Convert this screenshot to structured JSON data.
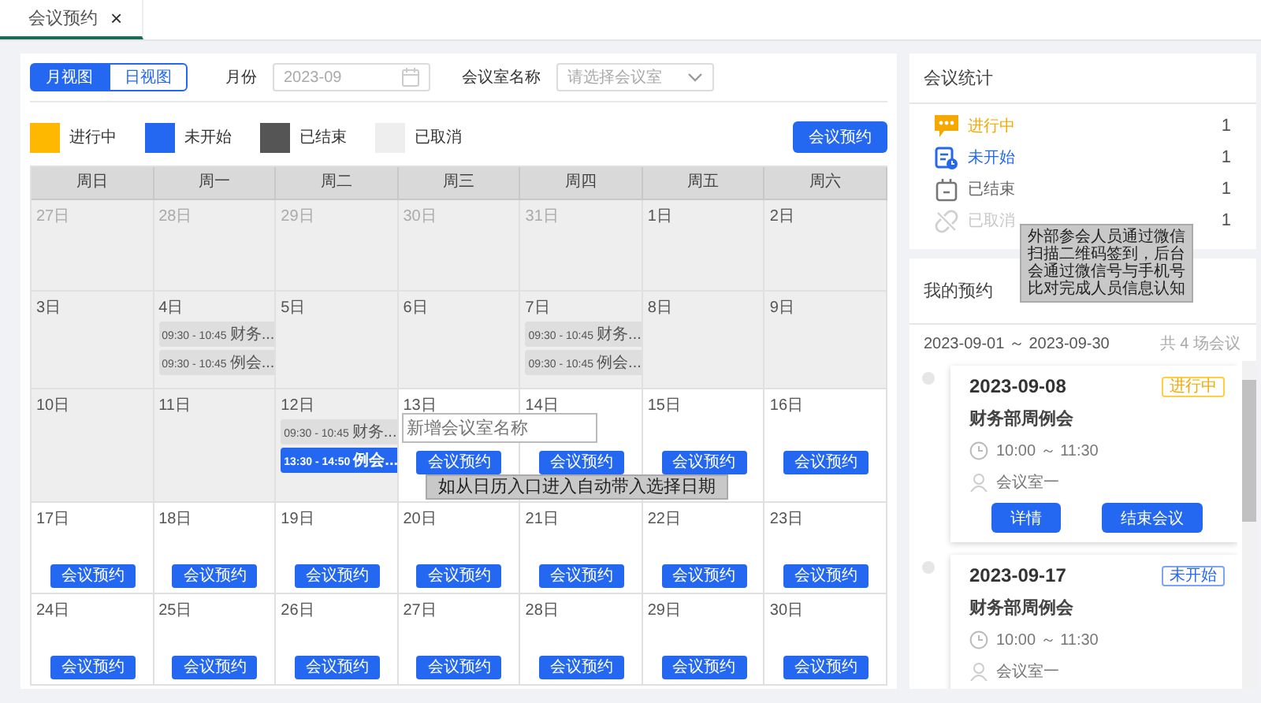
{
  "tabs": [
    {
      "label": "会议预约",
      "selected": true,
      "close": "×"
    }
  ],
  "toolbar": {
    "views": [
      {
        "label": "月视图",
        "selected": true
      },
      {
        "label": "日视图",
        "selected": false
      }
    ],
    "month_label": "月份",
    "month_value": "2023-09",
    "room_label": "会议室名称",
    "room_placeholder": "请选择会议室"
  },
  "legend": [
    {
      "label": "进行中",
      "color": "#ffb800"
    },
    {
      "label": "未开始",
      "color": "#2468f2"
    },
    {
      "label": "已结束",
      "color": "#555555"
    },
    {
      "label": "已取消",
      "color": "#eeeeee"
    }
  ],
  "book_button": "会议预约",
  "calendar": {
    "weekdays": [
      "周日",
      "周一",
      "周二",
      "周三",
      "周四",
      "周五",
      "周六"
    ],
    "weeks": [
      [
        {
          "day": "27日",
          "other_month": true,
          "past": true
        },
        {
          "day": "28日",
          "other_month": true,
          "past": true
        },
        {
          "day": "29日",
          "other_month": true,
          "past": true
        },
        {
          "day": "30日",
          "other_month": true,
          "past": true
        },
        {
          "day": "31日",
          "other_month": true,
          "past": true
        },
        {
          "day": "1日",
          "other_month": false,
          "past": true
        },
        {
          "day": "2日",
          "other_month": false,
          "past": true
        }
      ],
      [
        {
          "day": "3日",
          "other_month": false,
          "past": true
        },
        {
          "day": "4日",
          "other_month": false,
          "past": true,
          "events": [
            {
              "time": "09:30 - 10:45",
              "title": "财务...",
              "selected": false
            },
            {
              "time": "09:30 - 10:45",
              "title": "例会...",
              "selected": false
            }
          ]
        },
        {
          "day": "5日",
          "other_month": false,
          "past": true
        },
        {
          "day": "6日",
          "other_month": false,
          "past": true
        },
        {
          "day": "7日",
          "other_month": false,
          "past": true,
          "events": [
            {
              "time": "09:30 - 10:45",
              "title": "财务...",
              "selected": false
            },
            {
              "time": "09:30 - 10:45",
              "title": "例会...",
              "selected": false
            }
          ]
        },
        {
          "day": "8日",
          "other_month": false,
          "past": true
        },
        {
          "day": "9日",
          "other_month": false,
          "past": true
        }
      ],
      [
        {
          "day": "10日",
          "other_month": false,
          "past": true
        },
        {
          "day": "11日",
          "other_month": false,
          "past": true
        },
        {
          "day": "12日",
          "other_month": false,
          "past": true,
          "events": [
            {
              "time": "09:30 - 10:45",
              "title": "财务...",
              "selected": false
            },
            {
              "time": "13:30 - 14:50",
              "title": "例会...",
              "selected": true
            }
          ]
        },
        {
          "day": "13日",
          "other_month": false,
          "past": false,
          "button": "会议预约"
        },
        {
          "day": "14日",
          "other_month": false,
          "past": false,
          "button": "会议预约"
        },
        {
          "day": "15日",
          "other_month": false,
          "past": false,
          "button": "会议预约"
        },
        {
          "day": "16日",
          "other_month": false,
          "past": false,
          "button": "会议预约"
        }
      ],
      [
        {
          "day": "17日",
          "other_month": false,
          "past": false,
          "button": "会议预约"
        },
        {
          "day": "18日",
          "other_month": false,
          "past": false,
          "button": "会议预约"
        },
        {
          "day": "19日",
          "other_month": false,
          "past": false,
          "button": "会议预约"
        },
        {
          "day": "20日",
          "other_month": false,
          "past": false,
          "button": "会议预约"
        },
        {
          "day": "21日",
          "other_month": false,
          "past": false,
          "button": "会议预约"
        },
        {
          "day": "22日",
          "other_month": false,
          "past": false,
          "button": "会议预约"
        },
        {
          "day": "23日",
          "other_month": false,
          "past": false,
          "button": "会议预约"
        }
      ],
      [
        {
          "day": "24日",
          "other_month": false,
          "past": false,
          "button": "会议预约"
        },
        {
          "day": "25日",
          "other_month": false,
          "past": false,
          "button": "会议预约"
        },
        {
          "day": "26日",
          "other_month": false,
          "past": false,
          "button": "会议预约"
        },
        {
          "day": "27日",
          "other_month": false,
          "past": false,
          "button": "会议预约"
        },
        {
          "day": "28日",
          "other_month": false,
          "past": false,
          "button": "会议预约"
        },
        {
          "day": "29日",
          "other_month": false,
          "past": false,
          "button": "会议预约"
        },
        {
          "day": "30日",
          "other_month": false,
          "past": false,
          "button": "会议预约"
        }
      ]
    ]
  },
  "new_room_field": {
    "placeholder": "新增会议室名称"
  },
  "calendar_note": "如从日历入口进入自动带入选择日期",
  "stats": {
    "title": "会议统计",
    "items": [
      {
        "kind": "ongoing",
        "label": "进行中",
        "count": "1"
      },
      {
        "kind": "pending",
        "label": "未开始",
        "count": "1"
      },
      {
        "kind": "ended",
        "label": "已结束",
        "count": "1"
      },
      {
        "kind": "cancelled",
        "label": "已取消",
        "count": "1"
      }
    ]
  },
  "stats_note": "外部参会人员通过微信扫描二维码签到，后台会通过微信号与手机号比对完成人员信息认知",
  "my_bookings": {
    "title": "我的预约",
    "range": "2023-09-01 ～ 2023-09-30",
    "total": "共 4 场会议",
    "cards": [
      {
        "date": "2023-09-08",
        "status": {
          "kind": "ongoing",
          "label": "进行中"
        },
        "title": "财务部周例会",
        "time": "10:00 ～ 11:30",
        "room": "会议室一",
        "buttons": [
          "详情",
          "结束会议"
        ]
      },
      {
        "date": "2023-09-17",
        "status": {
          "kind": "pending",
          "label": "未开始"
        },
        "title": "财务部周例会",
        "time": "10:00 ～ 11:30",
        "room": "会议室一"
      }
    ]
  }
}
